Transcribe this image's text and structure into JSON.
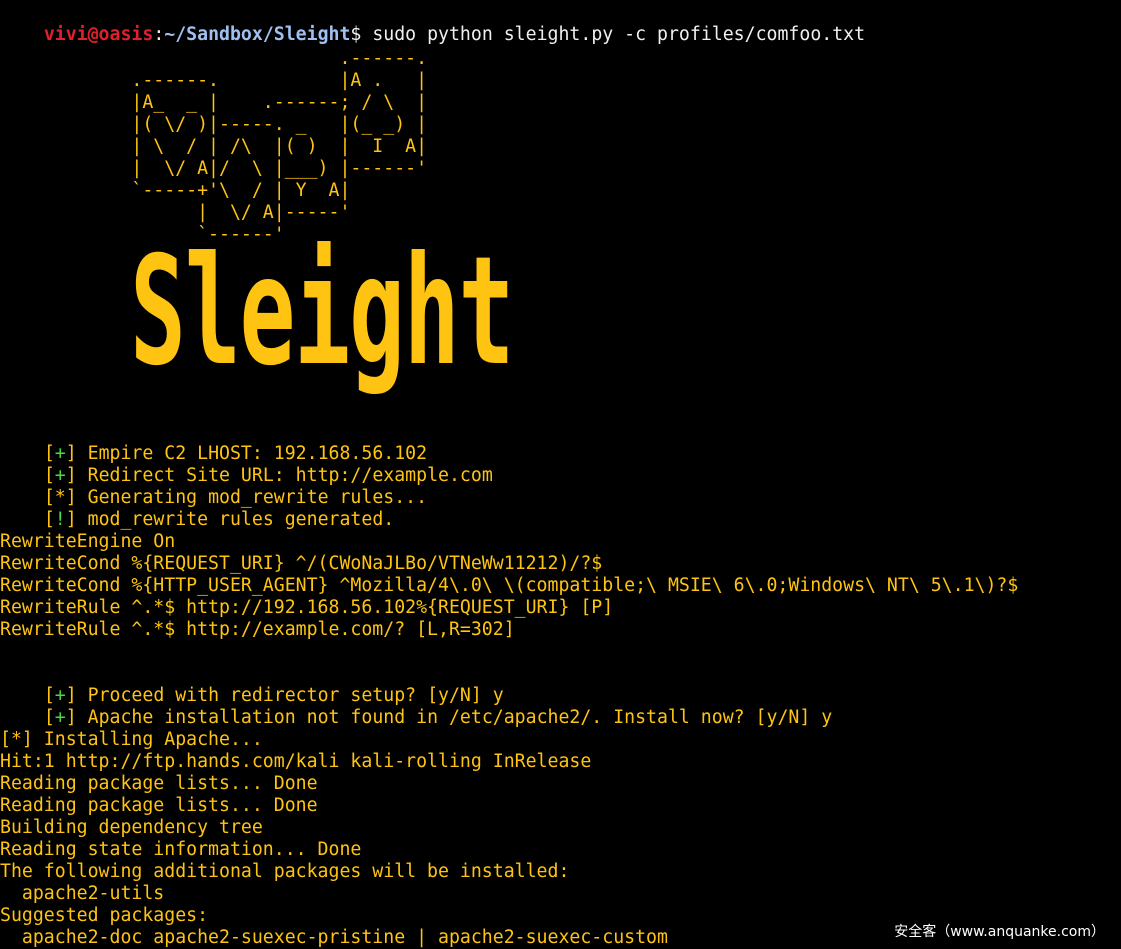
{
  "prompt": {
    "user": "vivi@oasis",
    "sep": ":",
    "path": "~/Sandbox/Sleight",
    "symbol": "$",
    "command": " sudo python sleight.py -c profiles/comfoo.txt"
  },
  "ascii_art": "                               .------.\n            .------.           |A .   |\n            |A_  _ |    .------; / \\  |\n            |( \\/ )|-----. _   |(_ _) |\n            | \\  / | /\\  |( )  |  I  A|\n            |  \\/ A|/  \\ |___) |------'\n            `-----+'\\  / | Y  A|\n                  |  \\/ A|-----'\n                  `------'",
  "logo": "Sleight",
  "status_lines": [
    {
      "tag_open": "[",
      "sym": "+",
      "tag_close": "]",
      "text": " Empire C2 LHOST: 192.168.56.102"
    },
    {
      "tag_open": "[",
      "sym": "+",
      "tag_close": "]",
      "text": " Redirect Site URL: http://example.com"
    },
    {
      "tag_open": "[",
      "sym": "*",
      "tag_close": "]",
      "text": " Generating mod_rewrite rules..."
    },
    {
      "tag_open": "[",
      "sym": "!",
      "tag_close": "]",
      "text": " mod_rewrite rules generated."
    }
  ],
  "rewrite_rules": [
    "RewriteEngine On",
    "RewriteCond %{REQUEST_URI} ^/(CWoNaJLBo/VTNeWw11212)/?$",
    "RewriteCond %{HTTP_USER_AGENT} ^Mozilla/4\\.0\\ \\(compatible;\\ MSIE\\ 6\\.0;Windows\\ NT\\ 5\\.1\\)?$",
    "RewriteRule ^.*$ http://192.168.56.102%{REQUEST_URI} [P]",
    "RewriteRule ^.*$ http://example.com/? [L,R=302]"
  ],
  "prompts": [
    {
      "tag_open": "[",
      "sym": "+",
      "tag_close": "]",
      "text": " Proceed with redirector setup? [y/N] y"
    },
    {
      "tag_open": "[",
      "sym": "+",
      "tag_close": "]",
      "text": " Apache installation not found in /etc/apache2/. Install now? [y/N] y"
    }
  ],
  "install_output": [
    "[*] Installing Apache...",
    "Hit:1 http://ftp.hands.com/kali kali-rolling InRelease",
    "Reading package lists... Done",
    "Reading package lists... Done",
    "Building dependency tree",
    "Reading state information... Done",
    "The following additional packages will be installed:",
    "  apache2-utils",
    "Suggested packages:",
    "  apache2-doc apache2-suexec-pristine | apache2-suexec-custom"
  ],
  "watermark": "安全客（www.anquanke.com）",
  "colors": {
    "background": "#000000",
    "text_yellow": "#ffc412",
    "prompt_user_red": "#e0202a",
    "prompt_path_blue": "#9fc0f0",
    "tag_green": "#44dd44"
  }
}
